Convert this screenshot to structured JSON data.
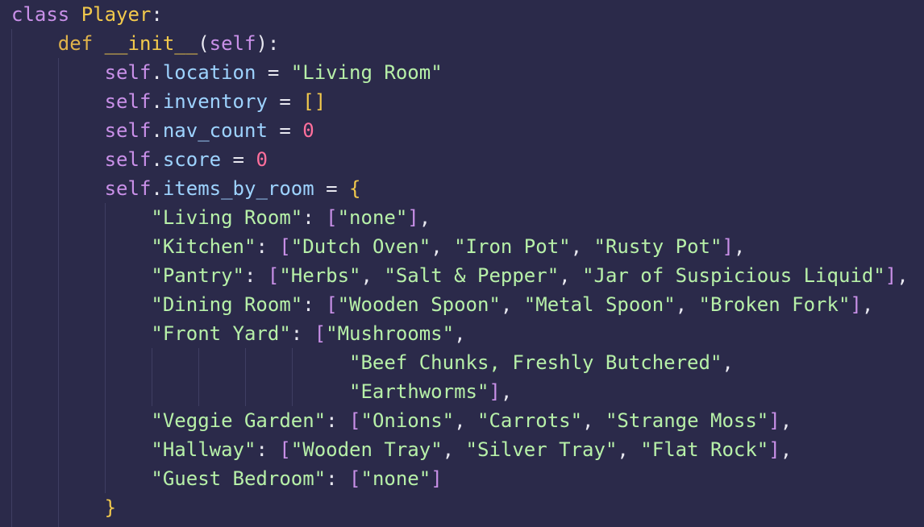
{
  "theme": {
    "background": "#2b2a4a",
    "keyword": "#c990e8",
    "classname": "#f2c94c",
    "attribute": "#9ed3ff",
    "string": "#b7f0a8",
    "number": "#ff6f9c",
    "text": "#e8e8f0"
  },
  "code": {
    "lines": [
      [
        {
          "t": "class",
          "c": "kw"
        },
        {
          "t": " ",
          "c": "plain"
        },
        {
          "t": "Player",
          "c": "cls"
        },
        {
          "t": ":",
          "c": "plain"
        }
      ],
      [
        {
          "t": "    ",
          "c": "plain"
        },
        {
          "t": "def",
          "c": "def"
        },
        {
          "t": " ",
          "c": "plain"
        },
        {
          "t": "__init__",
          "c": "cls"
        },
        {
          "t": "(",
          "c": "plain"
        },
        {
          "t": "self",
          "c": "self"
        },
        {
          "t": "):",
          "c": "plain"
        }
      ],
      [
        {
          "t": "        ",
          "c": "plain"
        },
        {
          "t": "self",
          "c": "self"
        },
        {
          "t": ".",
          "c": "plain"
        },
        {
          "t": "location",
          "c": "attr"
        },
        {
          "t": " = ",
          "c": "op"
        },
        {
          "t": "\"Living Room\"",
          "c": "str"
        }
      ],
      [
        {
          "t": "        ",
          "c": "plain"
        },
        {
          "t": "self",
          "c": "self"
        },
        {
          "t": ".",
          "c": "plain"
        },
        {
          "t": "inventory",
          "c": "attr"
        },
        {
          "t": " = ",
          "c": "op"
        },
        {
          "t": "[]",
          "c": "cls"
        }
      ],
      [
        {
          "t": "        ",
          "c": "plain"
        },
        {
          "t": "self",
          "c": "self"
        },
        {
          "t": ".",
          "c": "plain"
        },
        {
          "t": "nav_count",
          "c": "attr"
        },
        {
          "t": " = ",
          "c": "op"
        },
        {
          "t": "0",
          "c": "num"
        }
      ],
      [
        {
          "t": "        ",
          "c": "plain"
        },
        {
          "t": "self",
          "c": "self"
        },
        {
          "t": ".",
          "c": "plain"
        },
        {
          "t": "score",
          "c": "attr"
        },
        {
          "t": " = ",
          "c": "op"
        },
        {
          "t": "0",
          "c": "num"
        }
      ],
      [
        {
          "t": "        ",
          "c": "plain"
        },
        {
          "t": "self",
          "c": "self"
        },
        {
          "t": ".",
          "c": "plain"
        },
        {
          "t": "items_by_room",
          "c": "attr"
        },
        {
          "t": " = ",
          "c": "op"
        },
        {
          "t": "{",
          "c": "brace"
        }
      ],
      [
        {
          "t": "            ",
          "c": "plain"
        },
        {
          "t": "\"Living Room\"",
          "c": "str"
        },
        {
          "t": ": ",
          "c": "plain"
        },
        {
          "t": "[",
          "c": "brk"
        },
        {
          "t": "\"none\"",
          "c": "str"
        },
        {
          "t": "]",
          "c": "brk"
        },
        {
          "t": ",",
          "c": "plain"
        }
      ],
      [
        {
          "t": "            ",
          "c": "plain"
        },
        {
          "t": "\"Kitchen\"",
          "c": "str"
        },
        {
          "t": ": ",
          "c": "plain"
        },
        {
          "t": "[",
          "c": "brk"
        },
        {
          "t": "\"Dutch Oven\"",
          "c": "str"
        },
        {
          "t": ", ",
          "c": "plain"
        },
        {
          "t": "\"Iron Pot\"",
          "c": "str"
        },
        {
          "t": ", ",
          "c": "plain"
        },
        {
          "t": "\"Rusty Pot\"",
          "c": "str"
        },
        {
          "t": "]",
          "c": "brk"
        },
        {
          "t": ",",
          "c": "plain"
        }
      ],
      [
        {
          "t": "            ",
          "c": "plain"
        },
        {
          "t": "\"Pantry\"",
          "c": "str"
        },
        {
          "t": ": ",
          "c": "plain"
        },
        {
          "t": "[",
          "c": "brk"
        },
        {
          "t": "\"Herbs\"",
          "c": "str"
        },
        {
          "t": ", ",
          "c": "plain"
        },
        {
          "t": "\"Salt & Pepper\"",
          "c": "str"
        },
        {
          "t": ", ",
          "c": "plain"
        },
        {
          "t": "\"Jar of Suspicious Liquid\"",
          "c": "str"
        },
        {
          "t": "]",
          "c": "brk"
        },
        {
          "t": ",",
          "c": "plain"
        }
      ],
      [
        {
          "t": "            ",
          "c": "plain"
        },
        {
          "t": "\"Dining Room\"",
          "c": "str"
        },
        {
          "t": ": ",
          "c": "plain"
        },
        {
          "t": "[",
          "c": "brk"
        },
        {
          "t": "\"Wooden Spoon\"",
          "c": "str"
        },
        {
          "t": ", ",
          "c": "plain"
        },
        {
          "t": "\"Metal Spoon\"",
          "c": "str"
        },
        {
          "t": ", ",
          "c": "plain"
        },
        {
          "t": "\"Broken Fork\"",
          "c": "str"
        },
        {
          "t": "]",
          "c": "brk"
        },
        {
          "t": ",",
          "c": "plain"
        }
      ],
      [
        {
          "t": "            ",
          "c": "plain"
        },
        {
          "t": "\"Front Yard\"",
          "c": "str"
        },
        {
          "t": ": ",
          "c": "plain"
        },
        {
          "t": "[",
          "c": "brk"
        },
        {
          "t": "\"Mushrooms\"",
          "c": "str"
        },
        {
          "t": ",",
          "c": "plain"
        }
      ],
      [
        {
          "t": "                             ",
          "c": "plain"
        },
        {
          "t": "\"Beef Chunks, Freshly Butchered\"",
          "c": "str"
        },
        {
          "t": ",",
          "c": "plain"
        }
      ],
      [
        {
          "t": "                             ",
          "c": "plain"
        },
        {
          "t": "\"Earthworms\"",
          "c": "str"
        },
        {
          "t": "]",
          "c": "brk"
        },
        {
          "t": ",",
          "c": "plain"
        }
      ],
      [
        {
          "t": "            ",
          "c": "plain"
        },
        {
          "t": "\"Veggie Garden\"",
          "c": "str"
        },
        {
          "t": ": ",
          "c": "plain"
        },
        {
          "t": "[",
          "c": "brk"
        },
        {
          "t": "\"Onions\"",
          "c": "str"
        },
        {
          "t": ", ",
          "c": "plain"
        },
        {
          "t": "\"Carrots\"",
          "c": "str"
        },
        {
          "t": ", ",
          "c": "plain"
        },
        {
          "t": "\"Strange Moss\"",
          "c": "str"
        },
        {
          "t": "]",
          "c": "brk"
        },
        {
          "t": ",",
          "c": "plain"
        }
      ],
      [
        {
          "t": "            ",
          "c": "plain"
        },
        {
          "t": "\"Hallway\"",
          "c": "str"
        },
        {
          "t": ": ",
          "c": "plain"
        },
        {
          "t": "[",
          "c": "brk"
        },
        {
          "t": "\"Wooden Tray\"",
          "c": "str"
        },
        {
          "t": ", ",
          "c": "plain"
        },
        {
          "t": "\"Silver Tray\"",
          "c": "str"
        },
        {
          "t": ", ",
          "c": "plain"
        },
        {
          "t": "\"Flat Rock\"",
          "c": "str"
        },
        {
          "t": "]",
          "c": "brk"
        },
        {
          "t": ",",
          "c": "plain"
        }
      ],
      [
        {
          "t": "            ",
          "c": "plain"
        },
        {
          "t": "\"Guest Bedroom\"",
          "c": "str"
        },
        {
          "t": ": ",
          "c": "plain"
        },
        {
          "t": "[",
          "c": "brk"
        },
        {
          "t": "\"none\"",
          "c": "str"
        },
        {
          "t": "]",
          "c": "brk"
        }
      ],
      [
        {
          "t": "        ",
          "c": "plain"
        },
        {
          "t": "}",
          "c": "brace"
        }
      ]
    ]
  }
}
